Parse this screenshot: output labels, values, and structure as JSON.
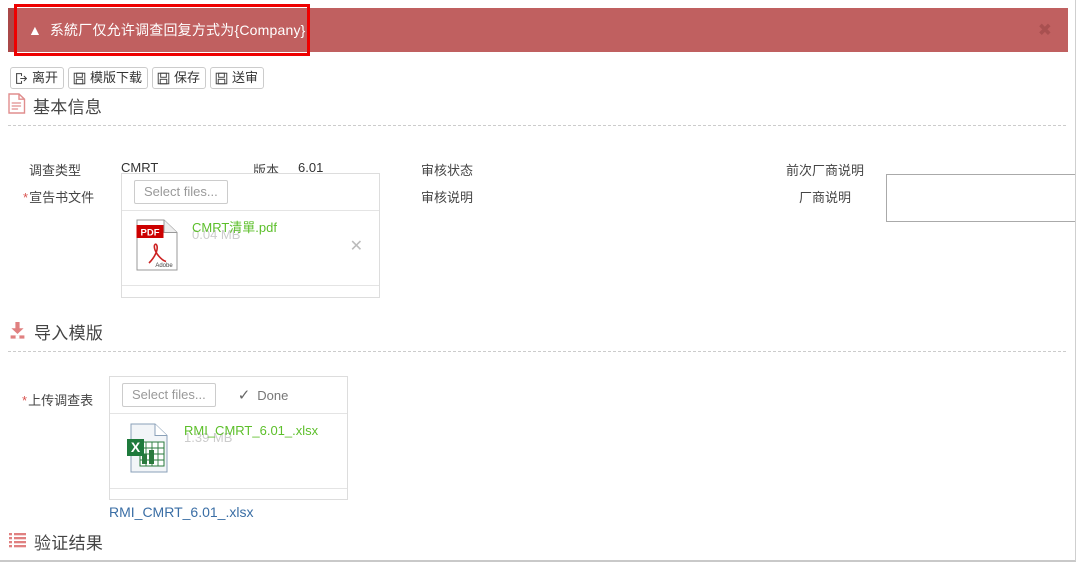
{
  "alert": {
    "icon": "warning-triangle-icon",
    "message": "系統厂仅允许调查回复方式为{Company}",
    "close_label": "✖",
    "bg_color": "#c06060",
    "border_color": "#a94848"
  },
  "annotation": {
    "color": "#ee0000"
  },
  "toolbar": {
    "buttons": [
      {
        "label": "离开",
        "icon": "logout-icon"
      },
      {
        "label": "模版下载",
        "icon": "save-icon"
      },
      {
        "label": "保存",
        "icon": "save-icon"
      },
      {
        "label": "送审",
        "icon": "save-icon"
      }
    ]
  },
  "sections": {
    "basic_info": {
      "title": "基本信息",
      "icon": "document-icon"
    },
    "import_template": {
      "title": "导入模版",
      "icon": "download-icon"
    },
    "validation_result": {
      "title": "验证结果",
      "icon": "list-icon"
    }
  },
  "basic_info": {
    "survey_type_label": "调查类型",
    "survey_type_value": "CMRT",
    "version_label": "版本",
    "version_value": "6.01",
    "declaration_label": "宣告书文件",
    "audit_status_label": "审核状态",
    "audit_status_value": "",
    "audit_note_label": "审核说明",
    "audit_note_value": "",
    "prev_vendor_note_label": "前次厂商说明",
    "prev_vendor_note_value": "",
    "vendor_note_label": "厂商说明",
    "vendor_note_value": ""
  },
  "declaration_uploader": {
    "select_files_label": "Select files...",
    "file": {
      "name": "CMRT清單.pdf",
      "size": "0.04 MB",
      "icon": "pdf-file-icon",
      "remove_label": "✕"
    }
  },
  "import_template": {
    "upload_label": "上传调查表",
    "select_files_label": "Select files...",
    "status_label": "Done",
    "status_icon": "check-icon",
    "file": {
      "name": "RMI_CMRT_6.01_.xlsx",
      "size": "1.39 MB",
      "icon": "excel-file-icon"
    },
    "download_link": "RMI_CMRT_6.01_.xlsx"
  }
}
